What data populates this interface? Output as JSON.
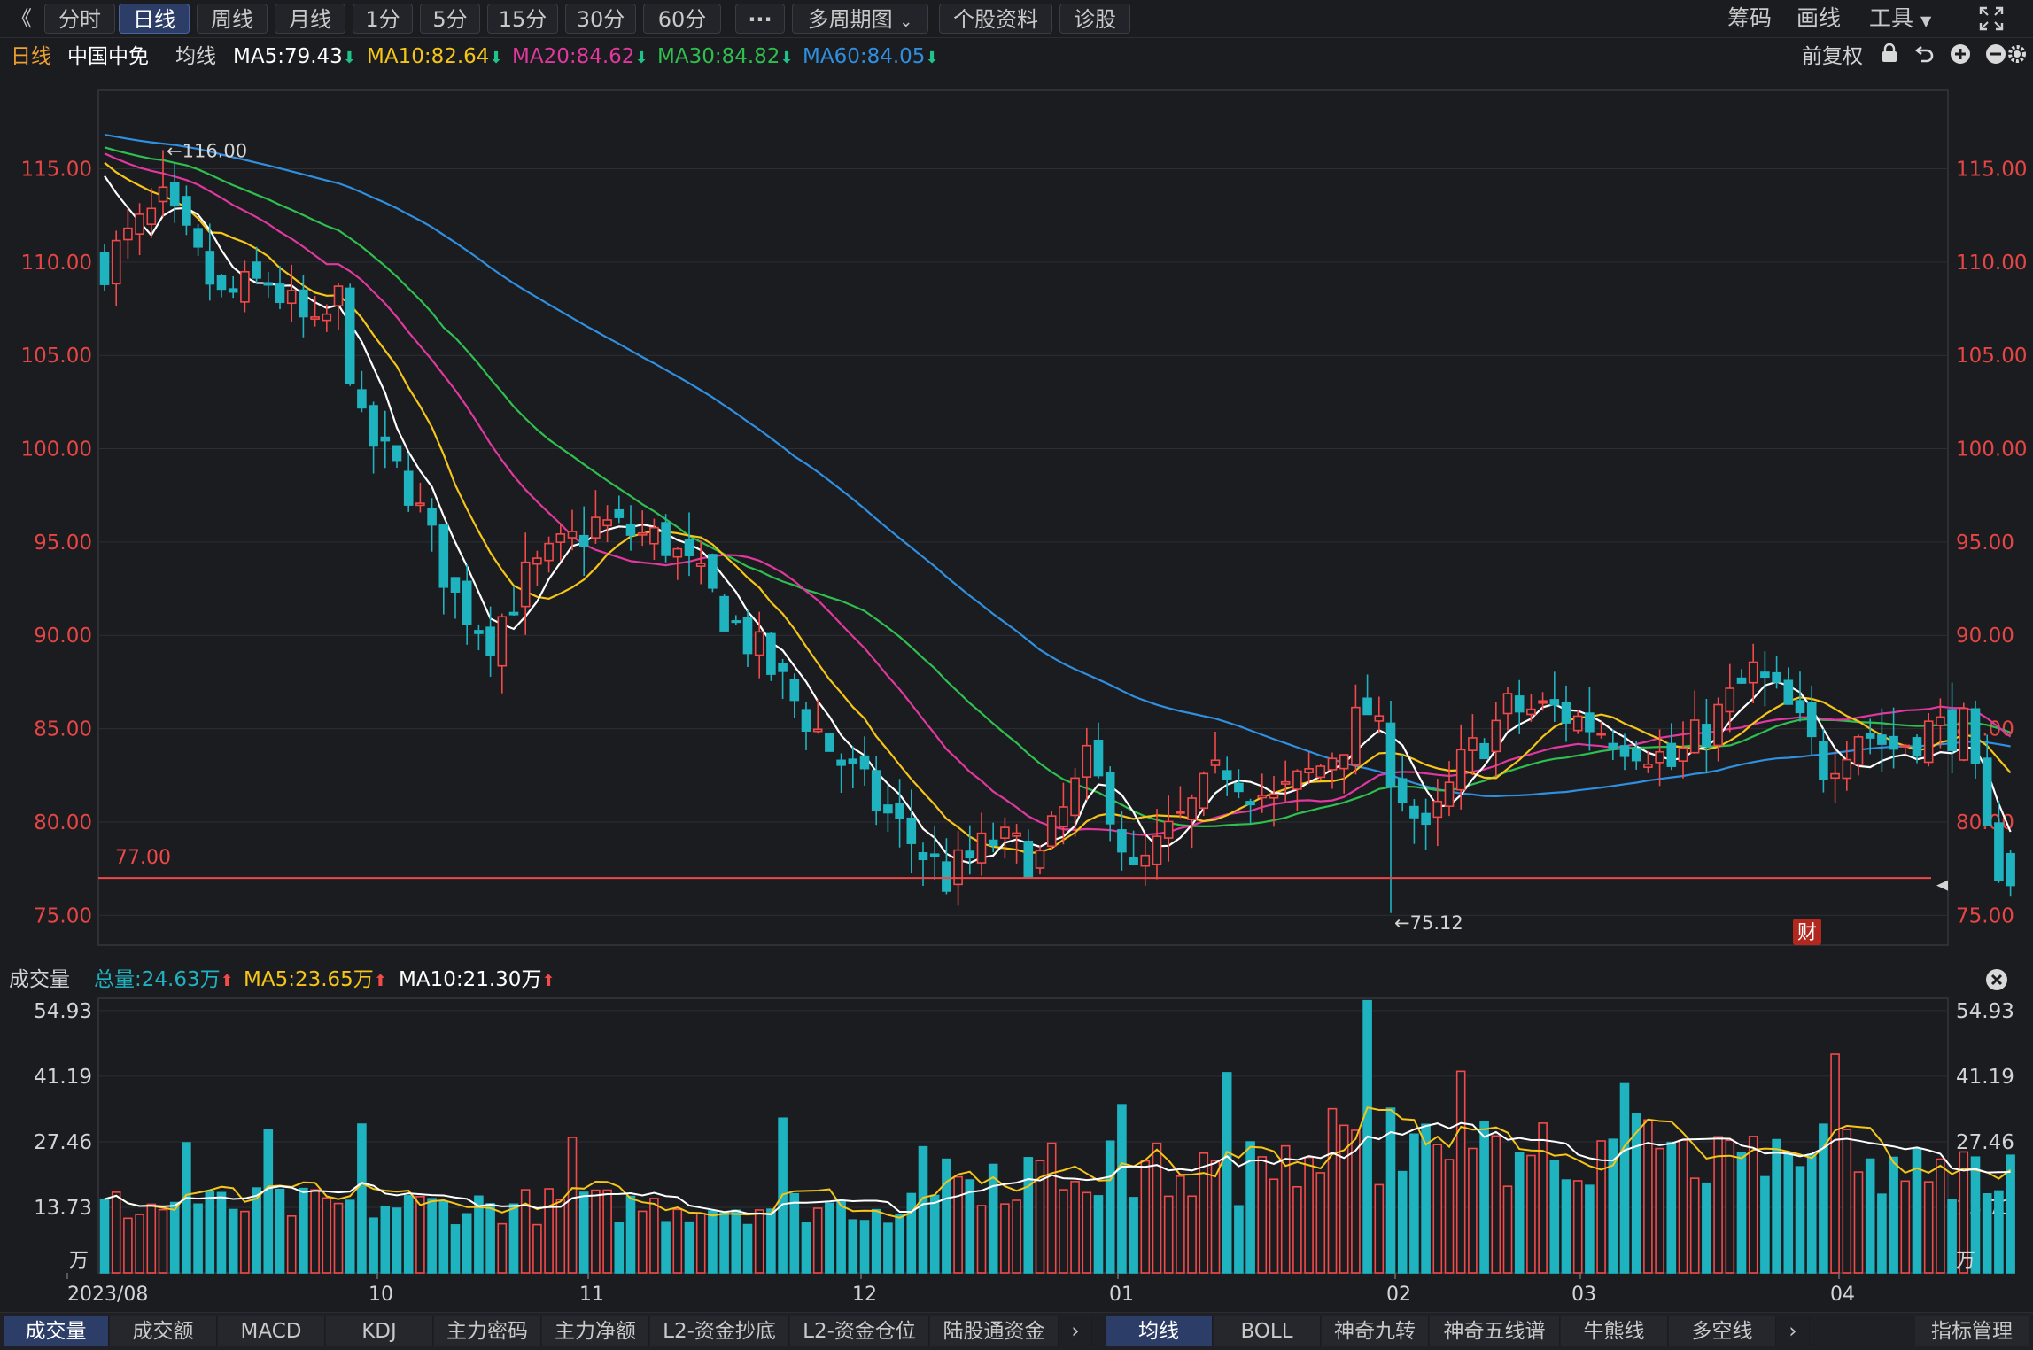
{
  "toolbar": {
    "back_glyph": "《",
    "tabs": [
      {
        "label": "分时",
        "active": false
      },
      {
        "label": "日线",
        "active": true
      },
      {
        "label": "周线",
        "active": false
      },
      {
        "label": "月线",
        "active": false
      },
      {
        "label": "1分",
        "active": false
      },
      {
        "label": "5分",
        "active": false
      },
      {
        "label": "15分",
        "active": false
      },
      {
        "label": "30分",
        "active": false
      },
      {
        "label": "60分",
        "active": false
      }
    ],
    "more_label": "···",
    "multi_period_label": "多周期图",
    "profile_label": "个股资料",
    "diagnose_label": "诊股",
    "chips_label": "筹码",
    "draw_label": "画线",
    "tools_label": "工具"
  },
  "info": {
    "period": "日线",
    "stock_name": "中国中免",
    "ma_label": "均线",
    "ma5": "MA5:79.43",
    "ma10": "MA10:82.64",
    "ma20": "MA20:84.62",
    "ma30": "MA30:84.82",
    "ma60": "MA60:84.05",
    "adjust": "前复权"
  },
  "colors": {
    "up": "#f24a4a",
    "down": "#1fb3c0",
    "ma5": "#ffffff",
    "ma10": "#f5c518",
    "ma20": "#e0389e",
    "ma30": "#2fbf4f",
    "ma60": "#2f8fe0",
    "axis_red": "#e64545",
    "text": "#d4d4d4"
  },
  "price_axis": {
    "ticks": [
      "115.00",
      "110.00",
      "105.00",
      "100.00",
      "95.00",
      "90.00",
      "85.00",
      "80.00",
      "75.00"
    ],
    "high_label": "←116.00",
    "low_label": "←75.12",
    "hline_label": "77.00",
    "finance_badge": "财"
  },
  "volume": {
    "title": "成交量",
    "total": "总量:24.63万",
    "ma5": "MA5:23.65万",
    "ma10": "MA10:21.30万",
    "ticks": [
      "54.93",
      "41.19",
      "27.46",
      "13.73"
    ],
    "unit": "万"
  },
  "x_axis": {
    "labels": [
      "2023/08",
      "10",
      "11",
      "12",
      "01",
      "02",
      "03",
      "04"
    ]
  },
  "bottom_tabs": {
    "left": [
      {
        "label": "成交量",
        "active": true
      },
      {
        "label": "成交额",
        "active": false
      },
      {
        "label": "MACD",
        "active": false
      },
      {
        "label": "KDJ",
        "active": false
      },
      {
        "label": "主力密码",
        "active": false
      },
      {
        "label": "主力净额",
        "active": false
      },
      {
        "label": "L2-资金抄底",
        "active": false
      },
      {
        "label": "L2-资金仓位",
        "active": false
      },
      {
        "label": "陆股通资金",
        "active": false
      }
    ],
    "right": [
      {
        "label": "均线",
        "active": true
      },
      {
        "label": "BOLL",
        "active": false
      },
      {
        "label": "神奇九转",
        "active": false
      },
      {
        "label": "神奇五线谱",
        "active": false
      },
      {
        "label": "牛熊线",
        "active": false
      },
      {
        "label": "多空线",
        "active": false
      }
    ],
    "indicator_manage": "指标管理"
  },
  "chart_data": {
    "type": "candlestick",
    "price_range": [
      73.4,
      119.2
    ],
    "volume_range": [
      0,
      57.5
    ],
    "hline": 77.0,
    "high_mark": 116.0,
    "low_mark": 75.12,
    "ma_end_values": {
      "ma5": 79.43,
      "ma10": 82.64,
      "ma20": 84.62,
      "ma30": 84.82,
      "ma60": 84.05
    },
    "trend_anchors": [
      [
        0,
        110
      ],
      [
        5,
        113
      ],
      [
        10,
        108
      ],
      [
        14,
        109
      ],
      [
        18,
        106
      ],
      [
        20,
        108
      ],
      [
        22,
        101
      ],
      [
        26,
        98
      ],
      [
        30,
        92
      ],
      [
        33,
        90
      ],
      [
        36,
        93
      ],
      [
        42,
        96
      ],
      [
        48,
        95
      ],
      [
        52,
        92
      ],
      [
        56,
        89
      ],
      [
        62,
        84
      ],
      [
        66,
        81
      ],
      [
        72,
        77
      ],
      [
        76,
        79
      ],
      [
        80,
        78
      ],
      [
        84,
        83
      ],
      [
        86,
        81
      ],
      [
        88,
        77
      ],
      [
        92,
        80
      ],
      [
        96,
        83
      ],
      [
        100,
        81
      ],
      [
        104,
        83
      ],
      [
        108,
        86
      ],
      [
        110,
        83
      ],
      [
        113,
        79
      ],
      [
        116,
        83
      ],
      [
        120,
        86
      ],
      [
        124,
        86
      ],
      [
        128,
        85
      ],
      [
        132,
        84
      ],
      [
        134,
        83
      ],
      [
        137,
        85
      ],
      [
        141,
        88
      ],
      [
        144,
        86
      ],
      [
        147,
        83
      ],
      [
        150,
        85
      ],
      [
        153,
        84
      ],
      [
        156,
        85
      ],
      [
        159,
        85
      ],
      [
        161,
        79
      ],
      [
        163,
        76.6
      ]
    ]
  }
}
